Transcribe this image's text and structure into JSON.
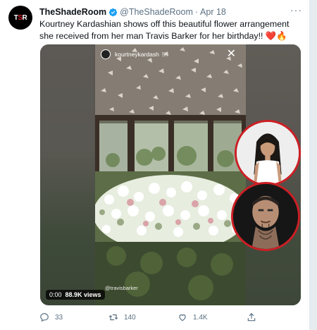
{
  "tweet": {
    "avatar_text_left": "T",
    "avatar_text_mid": "S",
    "avatar_text_right": "R",
    "display_name": "TheShadeRoom",
    "handle": "@TheShadeRoom",
    "separator": "·",
    "date": "Apr 18",
    "more_label": "···",
    "text": "Kourtney Kardashian shows off this beautiful flower arrangement she received from her man Travis Barker for her birthday!!",
    "text_emoji": "❤️🔥"
  },
  "media": {
    "ig_username": "kourtneykardash",
    "ig_time": "5h",
    "close_glyph": "✕",
    "watermark": "@travisbarker",
    "time": "0:00",
    "views": "88.9K views"
  },
  "actions": {
    "reply_count": "33",
    "retweet_count": "140",
    "like_count": "1.4K"
  },
  "colors": {
    "accent": "#1da1f2",
    "text": "#0f1419",
    "muted": "#5b7083",
    "circle_border": "#cc1f25"
  },
  "icons": {
    "verified": "verified-badge-icon",
    "reply": "reply-icon",
    "retweet": "retweet-icon",
    "like": "heart-icon",
    "share": "share-icon"
  }
}
